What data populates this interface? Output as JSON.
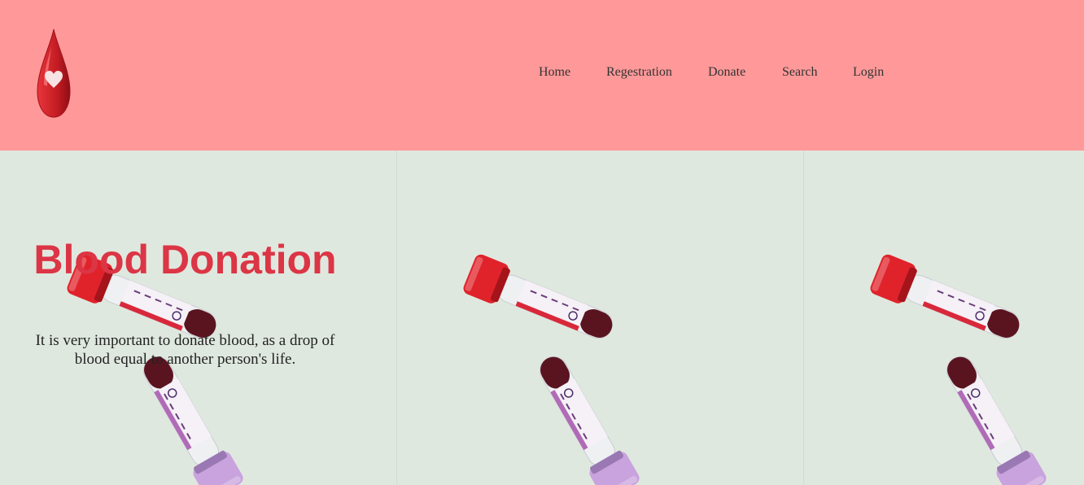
{
  "header": {
    "logo_icon": "blood-drop-heart-icon",
    "background_color": "#ff9999",
    "nav": [
      {
        "label": "Home"
      },
      {
        "label": "Regestration"
      },
      {
        "label": "Donate"
      },
      {
        "label": "Search"
      },
      {
        "label": "Login"
      }
    ]
  },
  "hero": {
    "title": "Blood Donation",
    "subtitle": "It is very important to donate blood, as a drop of blood equal to another person's life.",
    "title_color": "#dc3545",
    "background_color": "#dfe8df",
    "image": "blood-sample-tubes"
  }
}
